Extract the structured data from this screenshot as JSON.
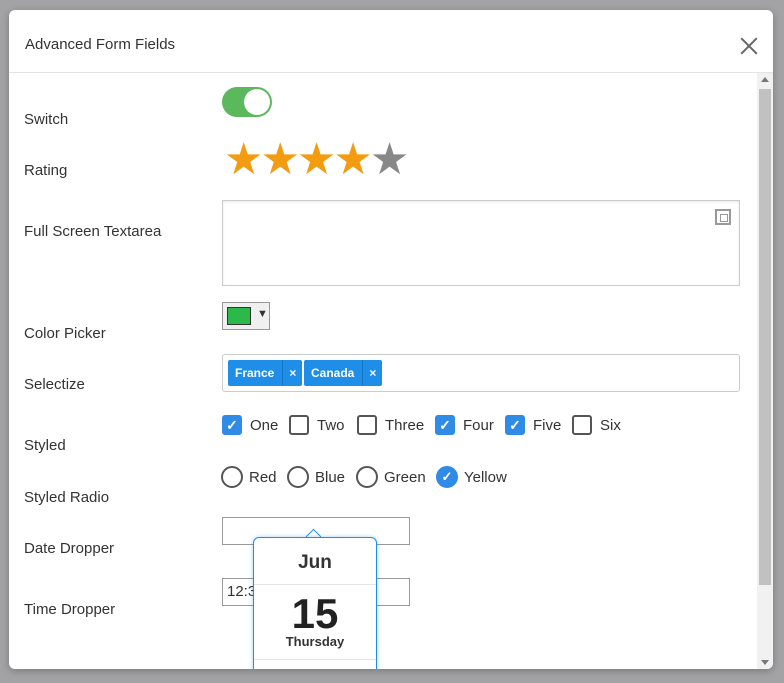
{
  "modal": {
    "title": "Advanced Form Fields"
  },
  "fields": {
    "switch_label": "Switch",
    "rating_label": "Rating",
    "textarea_label": "Full Screen Textarea",
    "color_label": "Color Picker",
    "selectize_label": "Selectize",
    "styled_label": "Styled",
    "radio_label": "Styled Radio",
    "date_label": "Date Dropper",
    "time_label": "Time Dropper"
  },
  "switch": {
    "on": true
  },
  "rating": {
    "value": 4,
    "max": 5
  },
  "color": {
    "value": "#2db84a"
  },
  "selectize": {
    "tags": [
      {
        "label": "France",
        "remove": "×"
      },
      {
        "label": "Canada",
        "remove": "×"
      }
    ]
  },
  "checkboxes": [
    {
      "label": "One",
      "checked": true
    },
    {
      "label": "Two",
      "checked": false
    },
    {
      "label": "Three",
      "checked": false
    },
    {
      "label": "Four",
      "checked": true
    },
    {
      "label": "Five",
      "checked": true
    },
    {
      "label": "Six",
      "checked": false
    }
  ],
  "radios": [
    {
      "label": "Red",
      "checked": false
    },
    {
      "label": "Blue",
      "checked": false
    },
    {
      "label": "Green",
      "checked": false
    },
    {
      "label": "Yellow",
      "checked": true
    }
  ],
  "date_input": {
    "value": ""
  },
  "time_input": {
    "value": "12:3"
  },
  "date_popup": {
    "month": "Jun",
    "day": "15",
    "weekday": "Thursday"
  },
  "colors": {
    "accent": "#2f8be6",
    "switch_on": "#5cb85c",
    "star": "#f39c12",
    "chip": "#1e8ee8"
  }
}
